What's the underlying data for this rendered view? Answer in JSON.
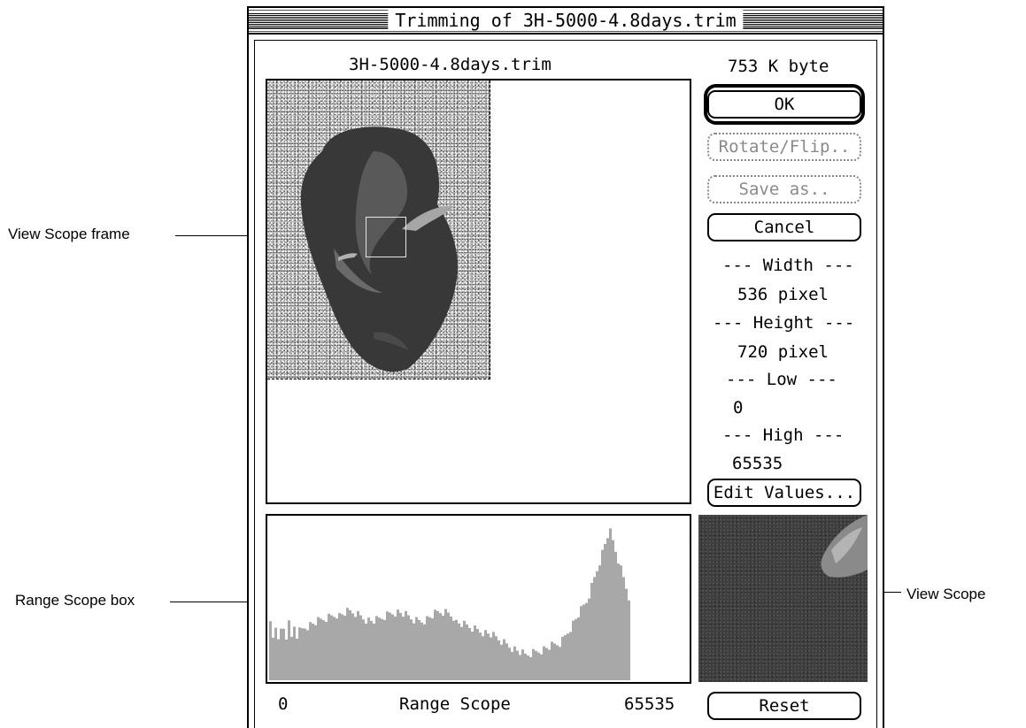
{
  "window": {
    "title": "Trimming of 3H-5000-4.8days.trim"
  },
  "header": {
    "file_name": "3H-5000-4.8days.trim",
    "file_size": "753  K byte"
  },
  "buttons": {
    "ok": "OK",
    "rotate_flip": "Rotate/Flip..",
    "save_as": "Save as..",
    "cancel": "Cancel",
    "edit_values": "Edit Values...",
    "reset": "Reset"
  },
  "info": {
    "width_heading": "--- Width ---",
    "width_value": "536  pixel",
    "height_heading": "--- Height ---",
    "height_value": "720  pixel",
    "low_heading": "--- Low ---",
    "low_value": "0",
    "high_heading": "--- High ---",
    "high_value": "65535"
  },
  "range_scope": {
    "min_label": "0",
    "title": "Range Scope",
    "max_label": "65535"
  },
  "callouts": {
    "view_scope_frame": "View Scope frame",
    "range_scope_box": "Range Scope box",
    "view_scope": "View Scope"
  },
  "colors": {
    "histogram_fill": "#a8a8a8",
    "disabled_text": "#8a8a8a"
  }
}
